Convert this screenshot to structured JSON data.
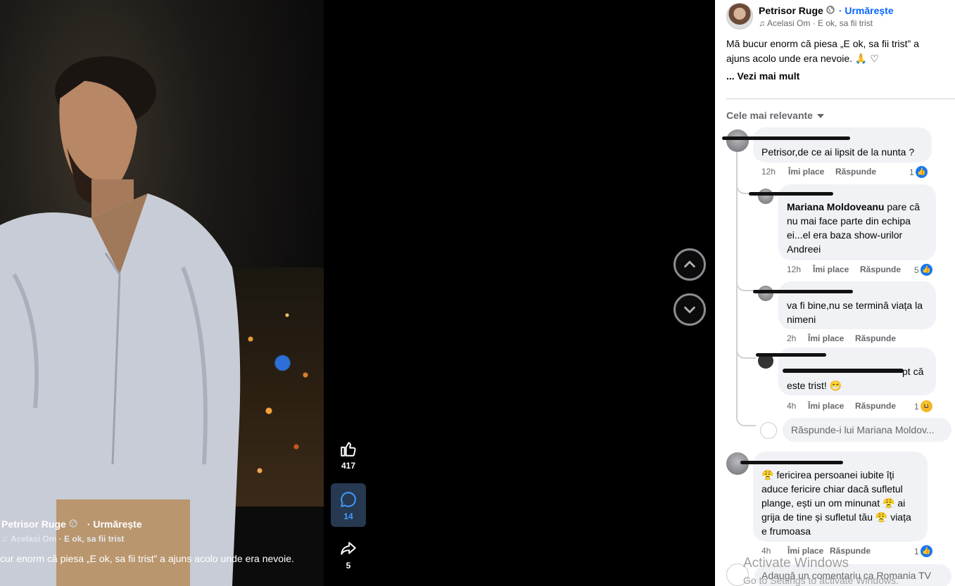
{
  "video": {
    "author": "Petrisor Ruge",
    "follow": "· Urmărește",
    "song": "Acelasi Om · E ok, sa fii trist",
    "caption": "cur enorm că piesa „E ok, sa fii trist” a ajuns acolo unde era nevoie."
  },
  "rail": {
    "likes": "417",
    "comments": "14",
    "shares": "5"
  },
  "post": {
    "author": "Petrisor Ruge",
    "follow": "· Urmărește",
    "song": "Acelasi Om · E ok, sa fii trist",
    "text": "Mă bucur enorm că piesa „E ok, sa fii trist” a ajuns acolo unde era nevoie. 🙏 ♡",
    "see_more": "... Vezi mai mult",
    "sort_label": "Cele mai relevante"
  },
  "comments": [
    {
      "text": "Petrisor,de ce ai lipsit de la nunta ?",
      "time": "12h",
      "like": "Îmi place",
      "reply": "Răspunde",
      "reactions": "1"
    },
    {
      "mention": "Mariana Moldoveanu",
      "text": " pare că nu mai face parte din echipa ei...el era baza show-urilor Andreei",
      "time": "12h",
      "like": "Îmi place",
      "reply": "Răspunde",
      "reactions": "5"
    },
    {
      "text": "va fi bine,nu se termină viața la nimeni",
      "time": "2h",
      "like": "Îmi place",
      "reply": "Răspunde"
    },
    {
      "text": "pt că este trist! 😁",
      "time": "4h",
      "like": "Îmi place",
      "reply": "Răspunde",
      "reactions": "1"
    },
    {
      "text": "😤 fericirea persoanei iubite îți aduce fericire chiar dacă sufletul plange, ești un om minunat 😤 ai grija de tine și sufletul tău 😤 viața e frumoasa",
      "time": "4h",
      "like": "Îmi place",
      "reply": "Răspunde",
      "reactions": "1"
    }
  ],
  "reply_placeholder": "Răspunde-i lui Mariana Moldov...",
  "add_comment_placeholder": "Adaugă un comentariu ca Romania TV",
  "watermark": {
    "line1": "Activate Windows",
    "line2": "Go to Settings to activate Windows."
  },
  "colors": {
    "accent": "#0866ff",
    "panel_bg": "#ffffff",
    "bubble_bg": "#f0f2f5"
  }
}
